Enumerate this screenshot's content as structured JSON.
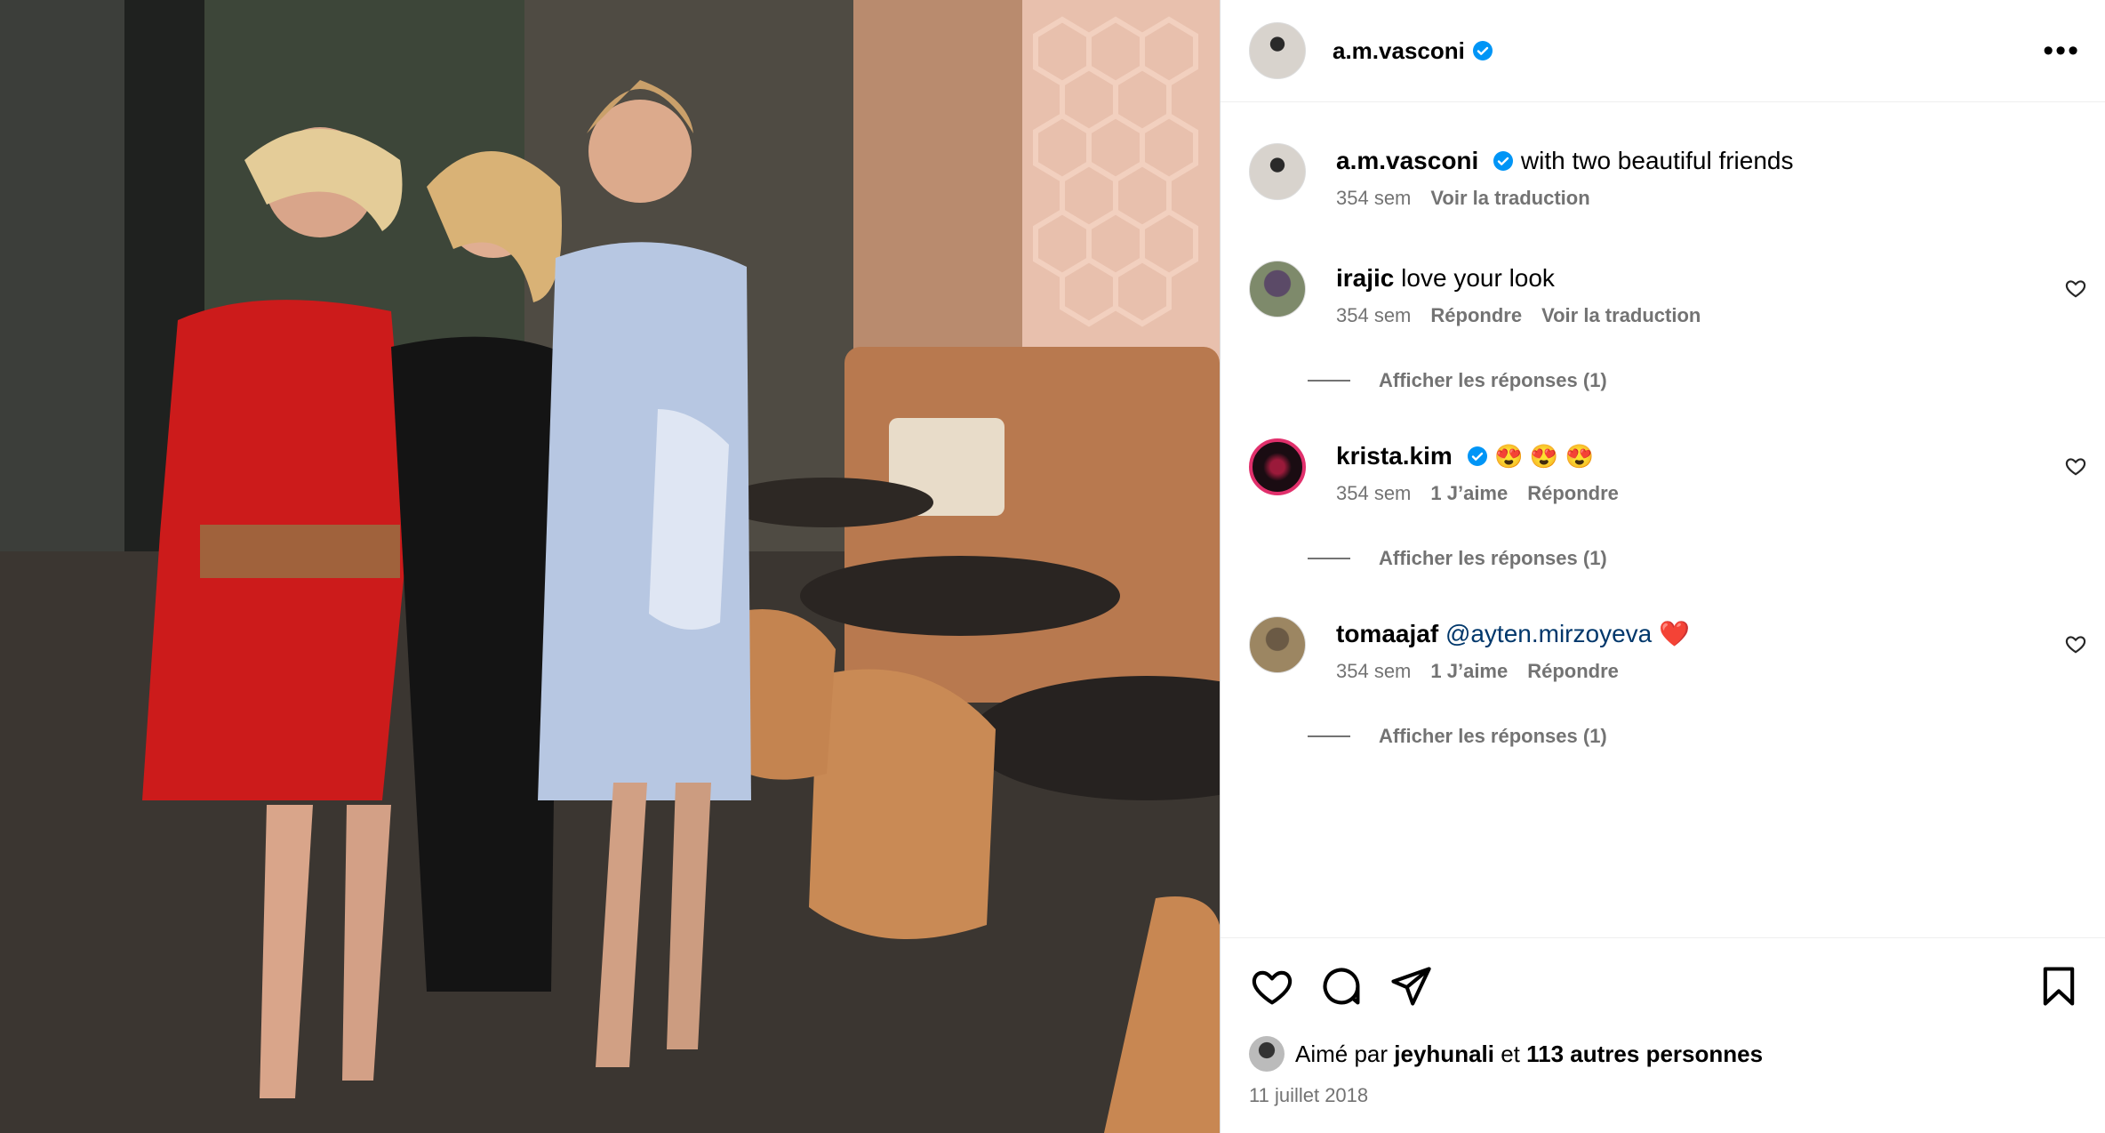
{
  "post": {
    "username": "a.m.vasconi",
    "more_label": "•••",
    "photo_alt": "photo"
  },
  "comments": [
    {
      "username": "a.m.vasconi",
      "verified": true,
      "text": "with two beautiful friends",
      "time": "354 sem",
      "actions": [
        "Voir la traduction"
      ],
      "is_caption": true
    },
    {
      "username": "irajic",
      "verified": false,
      "text": "love your look",
      "time": "354 sem",
      "actions": [
        "Répondre",
        "Voir la traduction"
      ],
      "replies": "Afficher les réponses (1)"
    },
    {
      "username": "krista.kim",
      "verified": true,
      "text": "😍 😍 😍",
      "time": "354 sem",
      "likes": "1 J’aime",
      "actions": [
        "Répondre"
      ],
      "replies": "Afficher les réponses (1)"
    },
    {
      "username": "tomaajaf",
      "verified": false,
      "mention": "@ayten.mirzoyeva",
      "text": "❤️",
      "time": "354 sem",
      "likes": "1 J’aime",
      "actions": [
        "Répondre"
      ],
      "replies": "Afficher les réponses (1)"
    }
  ],
  "footer": {
    "liked_prefix": "Aimé par",
    "liked_user": "jeyhunali",
    "liked_and": "et",
    "liked_others": "113 autres personnes",
    "date": "11 juillet 2018"
  },
  "icons": [
    "heart-icon",
    "comment-icon",
    "share-icon",
    "bookmark-icon"
  ],
  "colors": {
    "verified": "#0095f6",
    "meta": "#737373",
    "mention": "#00376b",
    "heart": "#ed4956"
  }
}
